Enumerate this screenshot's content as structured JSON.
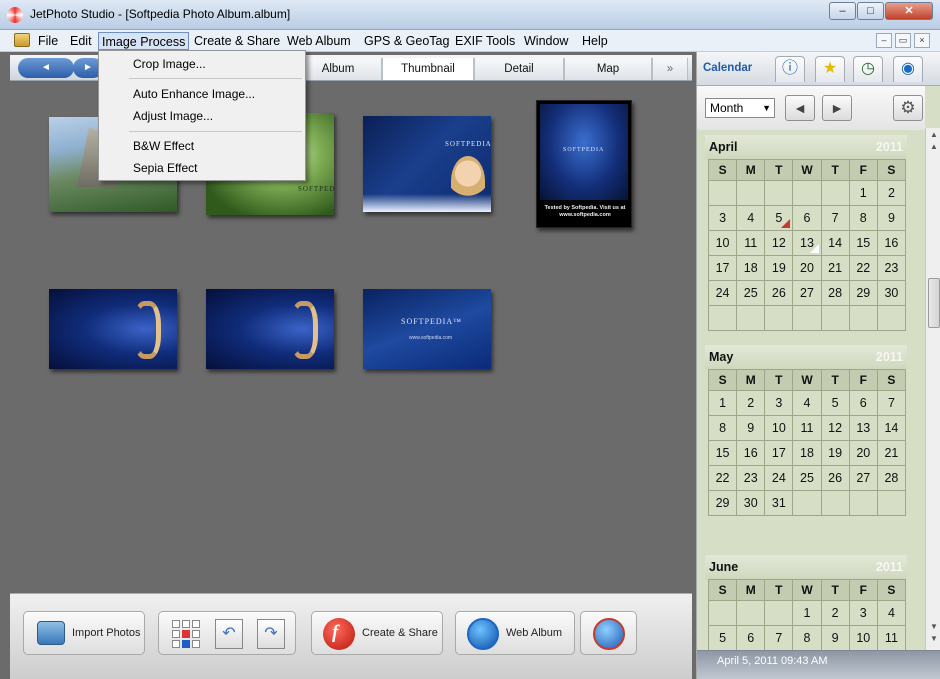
{
  "window": {
    "title": "JetPhoto Studio - [Softpedia Photo Album.album]",
    "minimize": "–",
    "maximize": "□",
    "close": "✕"
  },
  "menubar": {
    "items": [
      "File",
      "Edit",
      "Image Process",
      "Create & Share",
      "Web Album",
      "GPS & GeoTag",
      "EXIF Tools",
      "Window",
      "Help"
    ],
    "active": "Image Process",
    "mdi": [
      "–",
      "▭",
      "×"
    ]
  },
  "dropdown": {
    "items": [
      "Crop Image...",
      "Auto Enhance Image...",
      "Adjust Image...",
      "B&W Effect",
      "Sepia Effect"
    ]
  },
  "viewbar": {
    "back": "◄",
    "forward": "►",
    "path_hint": "softpedia",
    "tabs": [
      "Album",
      "Thumbnail",
      "Detail",
      "Map"
    ],
    "active_tab": "Thumbnail",
    "more": "»"
  },
  "thumbnails": [
    {
      "icon": "mountain-forest-photo"
    },
    {
      "icon": "green-forest-photo",
      "text": "SOFTPEDIA"
    },
    {
      "icon": "blue-woman-photo",
      "text": "SOFTPEDIA"
    },
    {
      "icon": "blue-poster-photo",
      "text": "SOFTPEDIA",
      "caption": "Tested by Softpedia. Visit us at www.softpedia.com"
    },
    {
      "icon": "blue-s-logo-photo"
    },
    {
      "icon": "blue-s-logo-photo-2"
    },
    {
      "icon": "softpedia-wallpaper-photo",
      "text": "SOFTPEDIA™",
      "sub": "www.softpedia.com"
    }
  ],
  "bottombar": {
    "import": "Import Photos",
    "create": "Create & Share",
    "web": "Web Album"
  },
  "calendar_panel": {
    "tab_label": "Calendar",
    "tab_icons": [
      "info-icon",
      "star-icon",
      "clock-icon",
      "globe-icon"
    ],
    "view_select": "Month",
    "prev": "◄",
    "next": "►",
    "gear": "⚙",
    "weekdays": [
      "S",
      "M",
      "T",
      "W",
      "T",
      "F",
      "S"
    ],
    "months": [
      {
        "name": "April",
        "year": "2011",
        "days": [
          "",
          "",
          "",
          "",
          "",
          "1",
          "2",
          "3",
          "4",
          "5",
          "6",
          "7",
          "8",
          "9",
          "10",
          "11",
          "12",
          "13",
          "14",
          "15",
          "16",
          "17",
          "18",
          "19",
          "20",
          "21",
          "22",
          "23",
          "24",
          "25",
          "26",
          "27",
          "28",
          "29",
          "30",
          "",
          "",
          "",
          "",
          "",
          "",
          ""
        ]
      },
      {
        "name": "May",
        "year": "2011",
        "days": [
          "1",
          "2",
          "3",
          "4",
          "5",
          "6",
          "7",
          "8",
          "9",
          "10",
          "11",
          "12",
          "13",
          "14",
          "15",
          "16",
          "17",
          "18",
          "19",
          "20",
          "21",
          "22",
          "23",
          "24",
          "25",
          "26",
          "27",
          "28",
          "29",
          "30",
          "31",
          "",
          "",
          "",
          ""
        ]
      },
      {
        "name": "June",
        "year": "2011",
        "days": [
          "",
          "",
          "",
          "1",
          "2",
          "3",
          "4",
          "5",
          "6",
          "7",
          "8",
          "9",
          "10",
          "11"
        ]
      }
    ],
    "marked_red": "5",
    "marked_white": "13",
    "status": "April 5, 2011  09:43 AM"
  }
}
